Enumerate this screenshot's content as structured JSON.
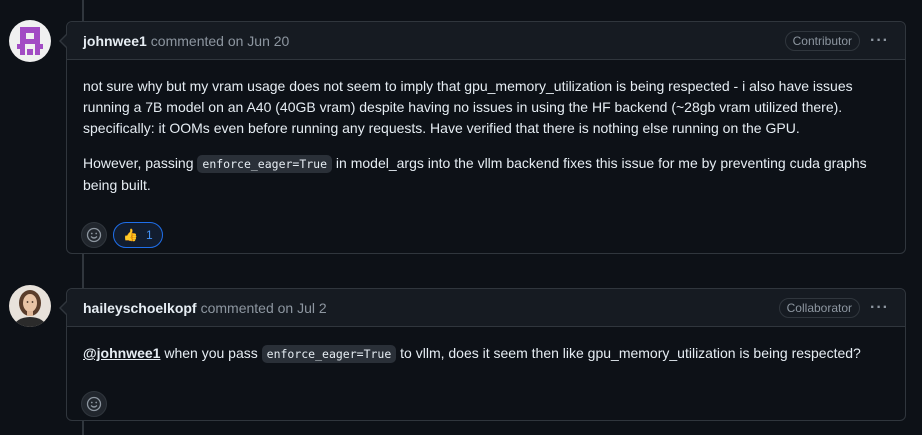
{
  "comments": [
    {
      "author": "johnwee1",
      "meta": "commented on Jun 20",
      "role": "Contributor",
      "body_p1": "not sure why but my vram usage does not seem to imply that gpu_memory_utilization is being respected - i also have issues running a 7B model on an A40 (40GB vram) despite having no issues in using the HF backend (~28gb vram utilized there). specifically: it OOMs even before running any requests. Have verified that there is nothing else running on the GPU.",
      "body_p2_pre": "However, passing",
      "body_p2_code": "enforce_eager=True",
      "body_p2_post": "in model_args into the vllm backend fixes this issue for me by preventing cuda graphs being built.",
      "reaction": {
        "emoji": "👍",
        "count": "1"
      }
    },
    {
      "author": "haileyschoelkopf",
      "meta": "commented on Jul 2",
      "role": "Collaborator",
      "mention": "@johnwee1",
      "body_pre": "when you pass",
      "body_code": "enforce_eager=True",
      "body_post": "to vllm, does it seem then like gpu_memory_utilization is being respected?"
    }
  ],
  "icons": {
    "more": "kebab-horizontal-icon",
    "add_reaction": "smiley-icon"
  },
  "colors": {
    "background": "#0d1117",
    "header_bg": "#161b22",
    "border": "#30363d",
    "muted": "#8d96a0",
    "accent": "#4493f8"
  }
}
